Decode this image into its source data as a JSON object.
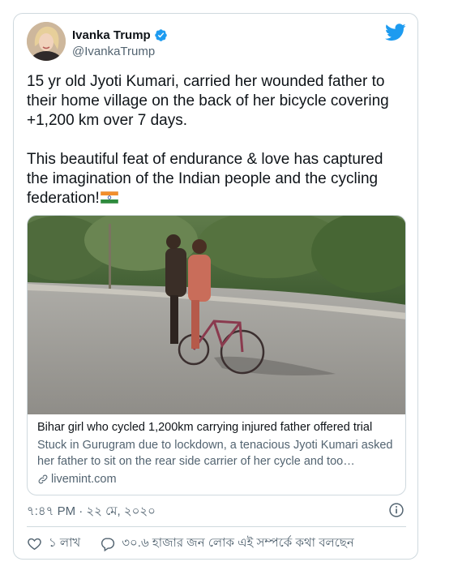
{
  "author": {
    "name": "Ivanka Trump",
    "handle": "@IvankaTrump"
  },
  "tweet": {
    "paragraph1": "15 yr old Jyoti Kumari, carried her wounded father to their home village on the back of her bicycle covering +1,200 km over 7 days.",
    "paragraph2": "This beautiful feat of endurance & love has captured the imagination of the Indian people and the cycling federation!",
    "emoji": "india-flag-icon"
  },
  "link_card": {
    "title": "Bihar girl who cycled 1,200km carrying injured father offered trial",
    "description": "Stuck in Gurugram due to lockdown, a tenacious Jyoti Kumari asked her father to sit on the rear side carrier of her cycle and too…",
    "domain": "livemint.com"
  },
  "timestamp": "৭:৪৭ PM · ২২ মে, ২০২০",
  "actions": {
    "likes": "১ লাখ",
    "reply_text": "৩০.৬ হাজার জন লোক এই সম্পর্কে কথা বলছেন"
  },
  "colors": {
    "brand": "#1d9bf0",
    "text": "#0f1419",
    "secondary": "#536471",
    "border": "#cfd9de"
  },
  "icons": [
    "verified-badge-icon",
    "twitter-bird-icon",
    "india-flag-icon",
    "link-icon",
    "info-icon",
    "heart-icon",
    "reply-bubble-icon"
  ]
}
